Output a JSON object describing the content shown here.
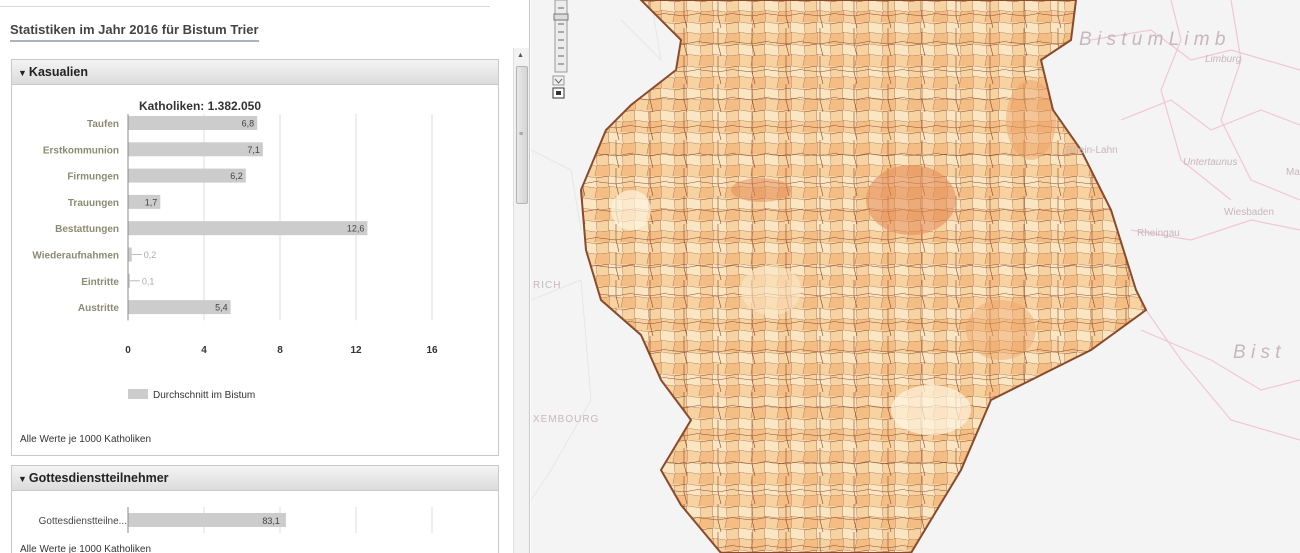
{
  "title": "Statistiken im Jahr 2016 für Bistum Trier",
  "panel1": {
    "header": "Kasualien",
    "chart_title": "Katholiken: 1.382.050",
    "legend": "Durchschnitt im Bistum",
    "footnote": "Alle Werte je 1000 Katholiken"
  },
  "panel2": {
    "header": "Gottesdienstteilnehmer",
    "footnote": "Alle Werte je 1000 Katholiken"
  },
  "chart_data": [
    {
      "type": "bar",
      "orientation": "horizontal",
      "title": "Katholiken: 1.382.050",
      "categories": [
        "Taufen",
        "Erstkommunion",
        "Firmungen",
        "Trauungen",
        "Bestattungen",
        "Wiederaufnahmen",
        "Eintritte",
        "Austritte"
      ],
      "values": [
        6.8,
        7.1,
        6.2,
        1.7,
        12.6,
        0.2,
        0.1,
        5.4
      ],
      "value_labels": [
        "6,8",
        "7,1",
        "6,2",
        "1,7",
        "12,6",
        "0,2",
        "0,1",
        "5,4"
      ],
      "xticks": [
        "0",
        "4",
        "8",
        "12",
        "16"
      ],
      "xlim": [
        0,
        16
      ],
      "grid": true,
      "legend": "Durchschnitt im Bistum",
      "legend_position": "bottom",
      "bar_color": "#cccccc"
    },
    {
      "type": "bar",
      "orientation": "horizontal",
      "categories": [
        "Gottesdienstteilne..."
      ],
      "values": [
        83.1
      ],
      "value_labels": [
        "83,1"
      ],
      "xlim": [
        0,
        160
      ],
      "grid": true,
      "bar_color": "#cccccc"
    }
  ],
  "map": {
    "labels": [
      "B i s t u m   L i m b",
      "Limburg",
      "Rhein-Lahn",
      "Untertaunus",
      "Wiesbaden",
      "Rheingau",
      "B i s t",
      "RICH",
      "XEMBOURG",
      "Ma"
    ],
    "colors": {
      "boundary": "#8a4a2c",
      "fills": [
        "#fbe6c4",
        "#f7d3a2",
        "#f3bd83",
        "#eda368",
        "#e38a55",
        "#fdf3de"
      ],
      "background": "#f4f4f4",
      "neighbour_lines": "#f1c7d2"
    }
  }
}
